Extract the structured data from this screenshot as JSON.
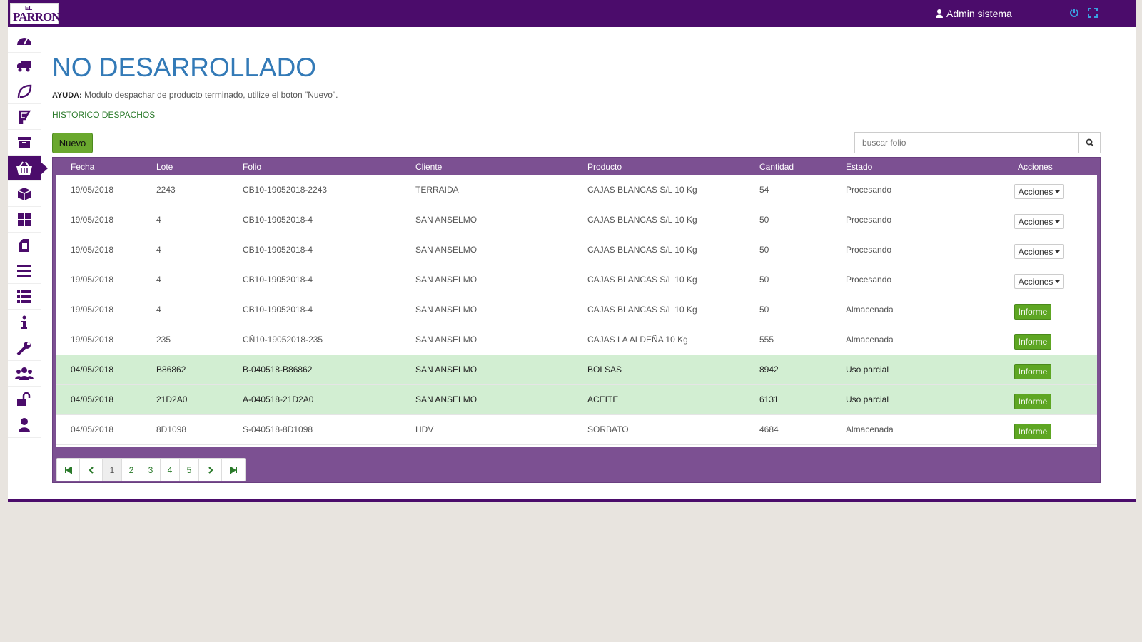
{
  "logo": {
    "top": "EL",
    "name": "PARRON"
  },
  "header": {
    "user": "Admin sistema",
    "icons": [
      "power-icon",
      "fullscreen-icon"
    ]
  },
  "sidebar": {
    "icons": [
      "dashboard-icon",
      "truck-icon",
      "leaf-icon",
      "flag-icon",
      "archive-icon",
      "basket-icon",
      "box-icon",
      "grid-icon",
      "tablet-icon",
      "server-icon",
      "list-icon",
      "info-icon",
      "wrench-icon",
      "users-icon",
      "unlock-icon",
      "user-icon"
    ],
    "active": 5
  },
  "page": {
    "title": "NO DESARROLLADO",
    "help_label": "AYUDA:",
    "help_text": " Modulo despachar de producto terminado, utilize el boton \"Nuevo\".",
    "history_link": "HISTORICO DESPACHOS",
    "new_button": "Nuevo",
    "search_placeholder": "buscar folio"
  },
  "table": {
    "headers": {
      "fecha": "Fecha",
      "lote": "Lote",
      "folio": "Folio",
      "cliente": "Cliente",
      "producto": "Producto",
      "cantidad": "Cantidad",
      "estado": "Estado",
      "acciones": "Acciones"
    },
    "rows": [
      {
        "fecha": "19/05/2018",
        "lote": "2243",
        "folio": "CB10-19052018-2243",
        "cliente": "TERRAIDA",
        "producto": "CAJAS BLANCAS S/L 10 Kg",
        "cantidad": "54",
        "estado": "Procesando",
        "action": "Acciones",
        "highlight": false
      },
      {
        "fecha": "19/05/2018",
        "lote": "4",
        "folio": "CB10-19052018-4",
        "cliente": "SAN ANSELMO",
        "producto": "CAJAS BLANCAS S/L 10 Kg",
        "cantidad": "50",
        "estado": "Procesando",
        "action": "Acciones",
        "highlight": false
      },
      {
        "fecha": "19/05/2018",
        "lote": "4",
        "folio": "CB10-19052018-4",
        "cliente": "SAN ANSELMO",
        "producto": "CAJAS BLANCAS S/L 10 Kg",
        "cantidad": "50",
        "estado": "Procesando",
        "action": "Acciones",
        "highlight": false
      },
      {
        "fecha": "19/05/2018",
        "lote": "4",
        "folio": "CB10-19052018-4",
        "cliente": "SAN ANSELMO",
        "producto": "CAJAS BLANCAS S/L 10 Kg",
        "cantidad": "50",
        "estado": "Procesando",
        "action": "Acciones",
        "highlight": false
      },
      {
        "fecha": "19/05/2018",
        "lote": "4",
        "folio": "CB10-19052018-4",
        "cliente": "SAN ANSELMO",
        "producto": "CAJAS BLANCAS S/L 10 Kg",
        "cantidad": "50",
        "estado": "Almacenada",
        "action": "Informe",
        "highlight": false
      },
      {
        "fecha": "19/05/2018",
        "lote": "235",
        "folio": "CÑ10-19052018-235",
        "cliente": "SAN ANSELMO",
        "producto": "CAJAS LA ALDEÑA 10 Kg",
        "cantidad": "555",
        "estado": "Almacenada",
        "action": "Informe",
        "highlight": false
      },
      {
        "fecha": "04/05/2018",
        "lote": "B86862",
        "folio": "B-040518-B86862",
        "cliente": "SAN ANSELMO",
        "producto": "BOLSAS",
        "cantidad": "8942",
        "estado": "Uso parcial",
        "action": "Informe",
        "highlight": true
      },
      {
        "fecha": "04/05/2018",
        "lote": "21D2A0",
        "folio": "A-040518-21D2A0",
        "cliente": "SAN ANSELMO",
        "producto": "ACEITE",
        "cantidad": "6131",
        "estado": "Uso parcial",
        "action": "Informe",
        "highlight": true
      },
      {
        "fecha": "04/05/2018",
        "lote": "8D1098",
        "folio": "S-040518-8D1098",
        "cliente": "HDV",
        "producto": "SORBATO",
        "cantidad": "4684",
        "estado": "Almacenada",
        "action": "Informe",
        "highlight": false
      }
    ]
  },
  "pagination": {
    "pages": [
      "1",
      "2",
      "3",
      "4",
      "5"
    ],
    "current": "1",
    "nav_icons": [
      "first-page-icon",
      "prev-page-icon",
      "next-page-icon",
      "last-page-icon"
    ]
  }
}
